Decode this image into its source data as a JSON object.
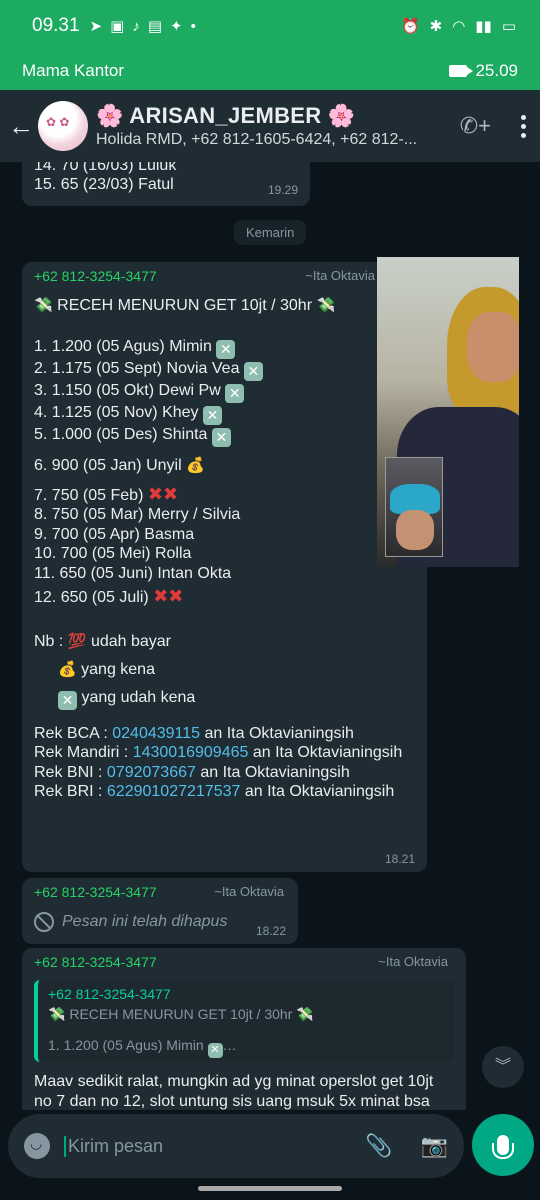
{
  "status": {
    "time": "09.31",
    "icons": [
      "telegram-icon",
      "shopee-icon",
      "tiktok-icon",
      "shopping-icon",
      "twitter-icon",
      "dot"
    ],
    "right": "alarm bt wifi signal",
    "battery": ""
  },
  "call": {
    "name": "Mama Kantor",
    "duration": "25.09"
  },
  "header": {
    "title": "🌸 ARISAN_JEMBER 🌸",
    "subtitle": "Holida RMD, +62 812-1605-6424, +62 812-..."
  },
  "messages": {
    "m1": {
      "line1": "14. 70 (16/03) Luluk",
      "line2": "15. 65 (23/03)  Fatul",
      "time": "19.29"
    },
    "date_pill": "Kemarin",
    "m2": {
      "sender": "+62 812-3254-3477",
      "alias": "~Ita Oktavia",
      "title": "RECEH MENURUN GET 10jt / 30hr",
      "list": [
        "1. 1.200 (05 Agus) Mimin",
        "2. 1.175 (05 Sept) Novia Vea",
        "3. 1.150 (05 Okt) Dewi Pw",
        "4. 1.125 (05 Nov) Khey",
        "5. 1.000 (05 Des) Shinta",
        "6. 900 (05 Jan) Unyil",
        "7. 750 (05 Feb)",
        "8. 750 (05 Mar) Merry / Silvia",
        "9. 700 (05 Apr) Basma",
        "10. 700 (05 Mei) Rolla",
        "11. 650 (05 Juni) Intan Okta",
        "12. 650 (05 Juli)"
      ],
      "nb1": "Nb :",
      "nb1b": "udah bayar",
      "nb2": "yang kena",
      "nb3": "yang udah kena",
      "rek": [
        {
          "label": "Rek BCA : ",
          "num": "0240439115",
          "name": " an Ita Oktavianingsih"
        },
        {
          "label": "Rek Mandiri : ",
          "num": "1430016909465",
          "name": " an Ita Oktavianingsih"
        },
        {
          "label": "Rek BNI : ",
          "num": "0792073667",
          "name": " an Ita Oktavianingsih"
        },
        {
          "label": "Rek BRI : ",
          "num": "622901027217537",
          "name": " an Ita Oktavianingsih"
        }
      ],
      "time": "18.21"
    },
    "m3": {
      "sender": "+62 812-3254-3477",
      "alias": "~Ita Oktavia",
      "text": "Pesan ini telah dihapus",
      "time": "18.22"
    },
    "m4": {
      "sender": "+62 812-3254-3477",
      "alias": "~Ita Oktavia",
      "quote_sender": "+62 812-3254-3477",
      "quote_title": "RECEH MENURUN GET 10jt / 30hr",
      "quote_line": "1. 1.200 (05 Agus) Mimin",
      "text": "Maav sedikit ralat, mungkin ad yg minat operslot get 10jt no 7 dan no 12, slot untung sis uang msuk 5x minat bsa"
    }
  },
  "input": {
    "placeholder": "Kirim pesan"
  }
}
